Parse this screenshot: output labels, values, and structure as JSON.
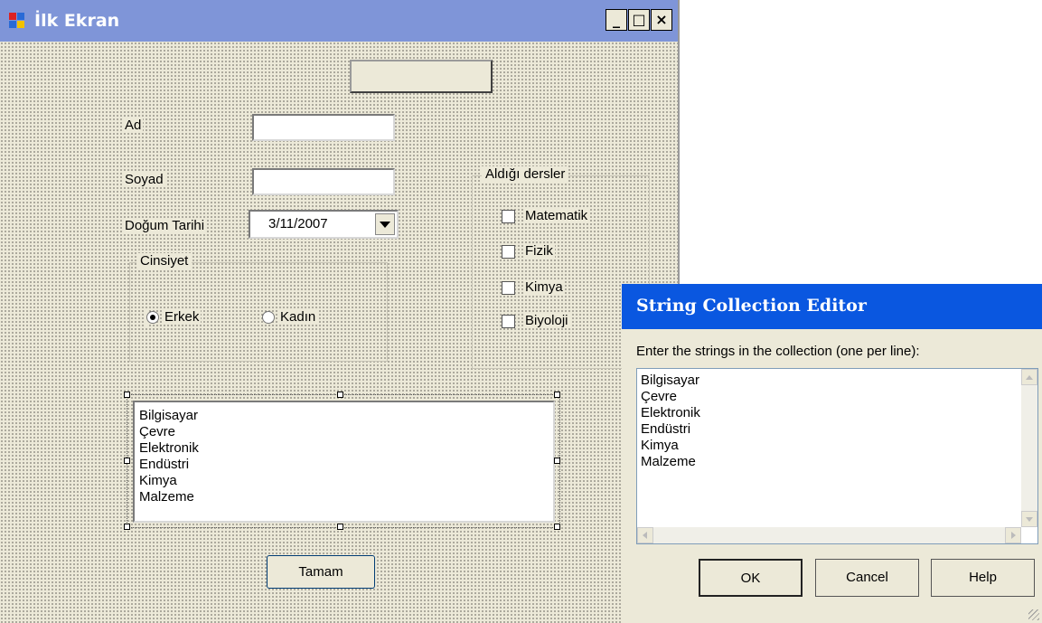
{
  "form": {
    "title": "İlk Ekran",
    "title_buttons": {
      "minimize": "_",
      "maximize": "□",
      "close": "×"
    },
    "labels": {
      "ad": "Ad",
      "soyad": "Soyad",
      "dogum_tarihi": "Doğum Tarihi"
    },
    "date_value": "3/11/2007",
    "cinsiyet": {
      "title": "Cinsiyet",
      "options": [
        {
          "label": "Erkek",
          "checked": true
        },
        {
          "label": "Kadın",
          "checked": false
        }
      ]
    },
    "dersler": {
      "title": "Aldığı dersler",
      "items": [
        {
          "label": "Matematik",
          "checked": false
        },
        {
          "label": "Fizik",
          "checked": false
        },
        {
          "label": "Kimya",
          "checked": false
        },
        {
          "label": "Biyoloji",
          "checked": false
        }
      ]
    },
    "listbox_items": [
      "Bilgisayar",
      "Çevre",
      "Elektronik",
      "Endüstri",
      "Kimya",
      "Malzeme"
    ],
    "ok_button": "Tamam"
  },
  "dialog": {
    "title": "String Collection Editor",
    "instruction": "Enter the strings in the collection (one per line):",
    "lines": [
      "Bilgisayar",
      "Çevre",
      "Elektronik",
      "Endüstri",
      "Kimya",
      "Malzeme"
    ],
    "buttons": {
      "ok": "OK",
      "cancel": "Cancel",
      "help": "Help"
    }
  },
  "colors": {
    "form_title_bar": "#7f95d8",
    "dialog_title_bar": "#0a57e0",
    "window_face": "#ece9d8"
  }
}
